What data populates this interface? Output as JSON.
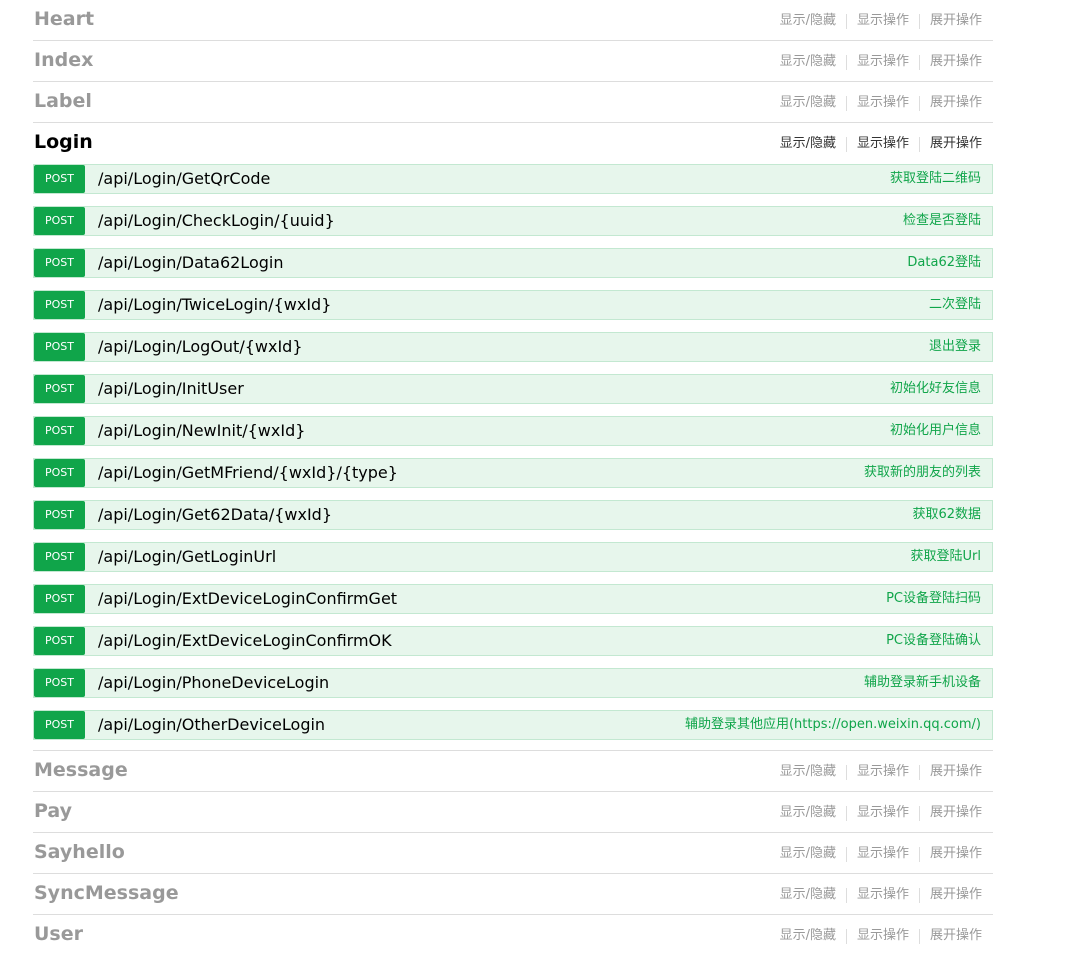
{
  "ops_labels": {
    "toggle": "显示/隐藏",
    "list": "显示操作",
    "expand": "展开操作"
  },
  "sections": {
    "heart": {
      "title": "Heart"
    },
    "index": {
      "title": "Index"
    },
    "label": {
      "title": "Label"
    },
    "login": {
      "title": "Login",
      "operations": [
        {
          "method": "POST",
          "path": "/api/Login/GetQrCode",
          "summary": "获取登陆二维码"
        },
        {
          "method": "POST",
          "path": "/api/Login/CheckLogin/{uuid}",
          "summary": "检查是否登陆"
        },
        {
          "method": "POST",
          "path": "/api/Login/Data62Login",
          "summary": "Data62登陆"
        },
        {
          "method": "POST",
          "path": "/api/Login/TwiceLogin/{wxId}",
          "summary": "二次登陆"
        },
        {
          "method": "POST",
          "path": "/api/Login/LogOut/{wxId}",
          "summary": "退出登录"
        },
        {
          "method": "POST",
          "path": "/api/Login/InitUser",
          "summary": "初始化好友信息"
        },
        {
          "method": "POST",
          "path": "/api/Login/NewInit/{wxId}",
          "summary": "初始化用户信息"
        },
        {
          "method": "POST",
          "path": "/api/Login/GetMFriend/{wxId}/{type}",
          "summary": "获取新的朋友的列表"
        },
        {
          "method": "POST",
          "path": "/api/Login/Get62Data/{wxId}",
          "summary": "获取62数据"
        },
        {
          "method": "POST",
          "path": "/api/Login/GetLoginUrl",
          "summary": "获取登陆Url"
        },
        {
          "method": "POST",
          "path": "/api/Login/ExtDeviceLoginConfirmGet",
          "summary": "PC设备登陆扫码"
        },
        {
          "method": "POST",
          "path": "/api/Login/ExtDeviceLoginConfirmOK",
          "summary": "PC设备登陆确认"
        },
        {
          "method": "POST",
          "path": "/api/Login/PhoneDeviceLogin",
          "summary": "辅助登录新手机设备"
        },
        {
          "method": "POST",
          "path": "/api/Login/OtherDeviceLogin",
          "summary": "辅助登录其他应用(https://open.weixin.qq.com/)"
        }
      ]
    },
    "message": {
      "title": "Message"
    },
    "pay": {
      "title": "Pay"
    },
    "sayhello": {
      "title": "Sayhello"
    },
    "syncmessage": {
      "title": "SyncMessage"
    },
    "user": {
      "title": "User"
    }
  },
  "colors": {
    "post_method_bg": "#10a54a",
    "op_row_bg": "#e7f6ec",
    "op_row_border": "#c3e8d1",
    "summary_text": "#10a54a",
    "inactive_title": "#999999"
  }
}
